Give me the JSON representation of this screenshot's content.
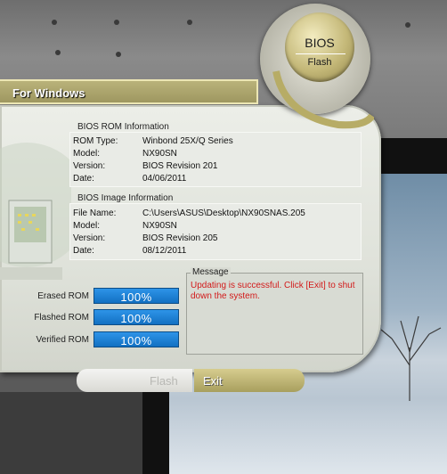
{
  "window": {
    "title": "For Windows",
    "logo_title": "BIOS",
    "logo_subtitle": "Flash"
  },
  "rom_info": {
    "heading": "BIOS ROM Information",
    "rows": [
      {
        "label": "ROM Type:",
        "value": "Winbond 25X/Q Series"
      },
      {
        "label": "Model:",
        "value": "NX90SN"
      },
      {
        "label": "Version:",
        "value": "BIOS Revision 201"
      },
      {
        "label": "Date:",
        "value": "04/06/2011"
      }
    ]
  },
  "image_info": {
    "heading": "BIOS Image Information",
    "rows": [
      {
        "label": "File Name:",
        "value": "C:\\Users\\ASUS\\Desktop\\NX90SNAS.205"
      },
      {
        "label": "Model:",
        "value": "NX90SN"
      },
      {
        "label": "Version:",
        "value": "BIOS Revision 205"
      },
      {
        "label": "Date:",
        "value": "08/12/2011"
      }
    ]
  },
  "message": {
    "label": "Message",
    "text": "Updating is successful. Click [Exit] to shut down the system."
  },
  "progress": [
    {
      "label": "Erased ROM",
      "value": "100%",
      "fraction": 1.0
    },
    {
      "label": "Flashed ROM",
      "value": "100%",
      "fraction": 1.0
    },
    {
      "label": "Verified ROM",
      "value": "100%",
      "fraction": 1.0
    }
  ],
  "buttons": {
    "flash": "Flash",
    "exit": "Exit"
  },
  "colors": {
    "accent_gold": "#b9b27a",
    "progress_blue": "#1777c9",
    "message_red": "#d21a1a"
  }
}
